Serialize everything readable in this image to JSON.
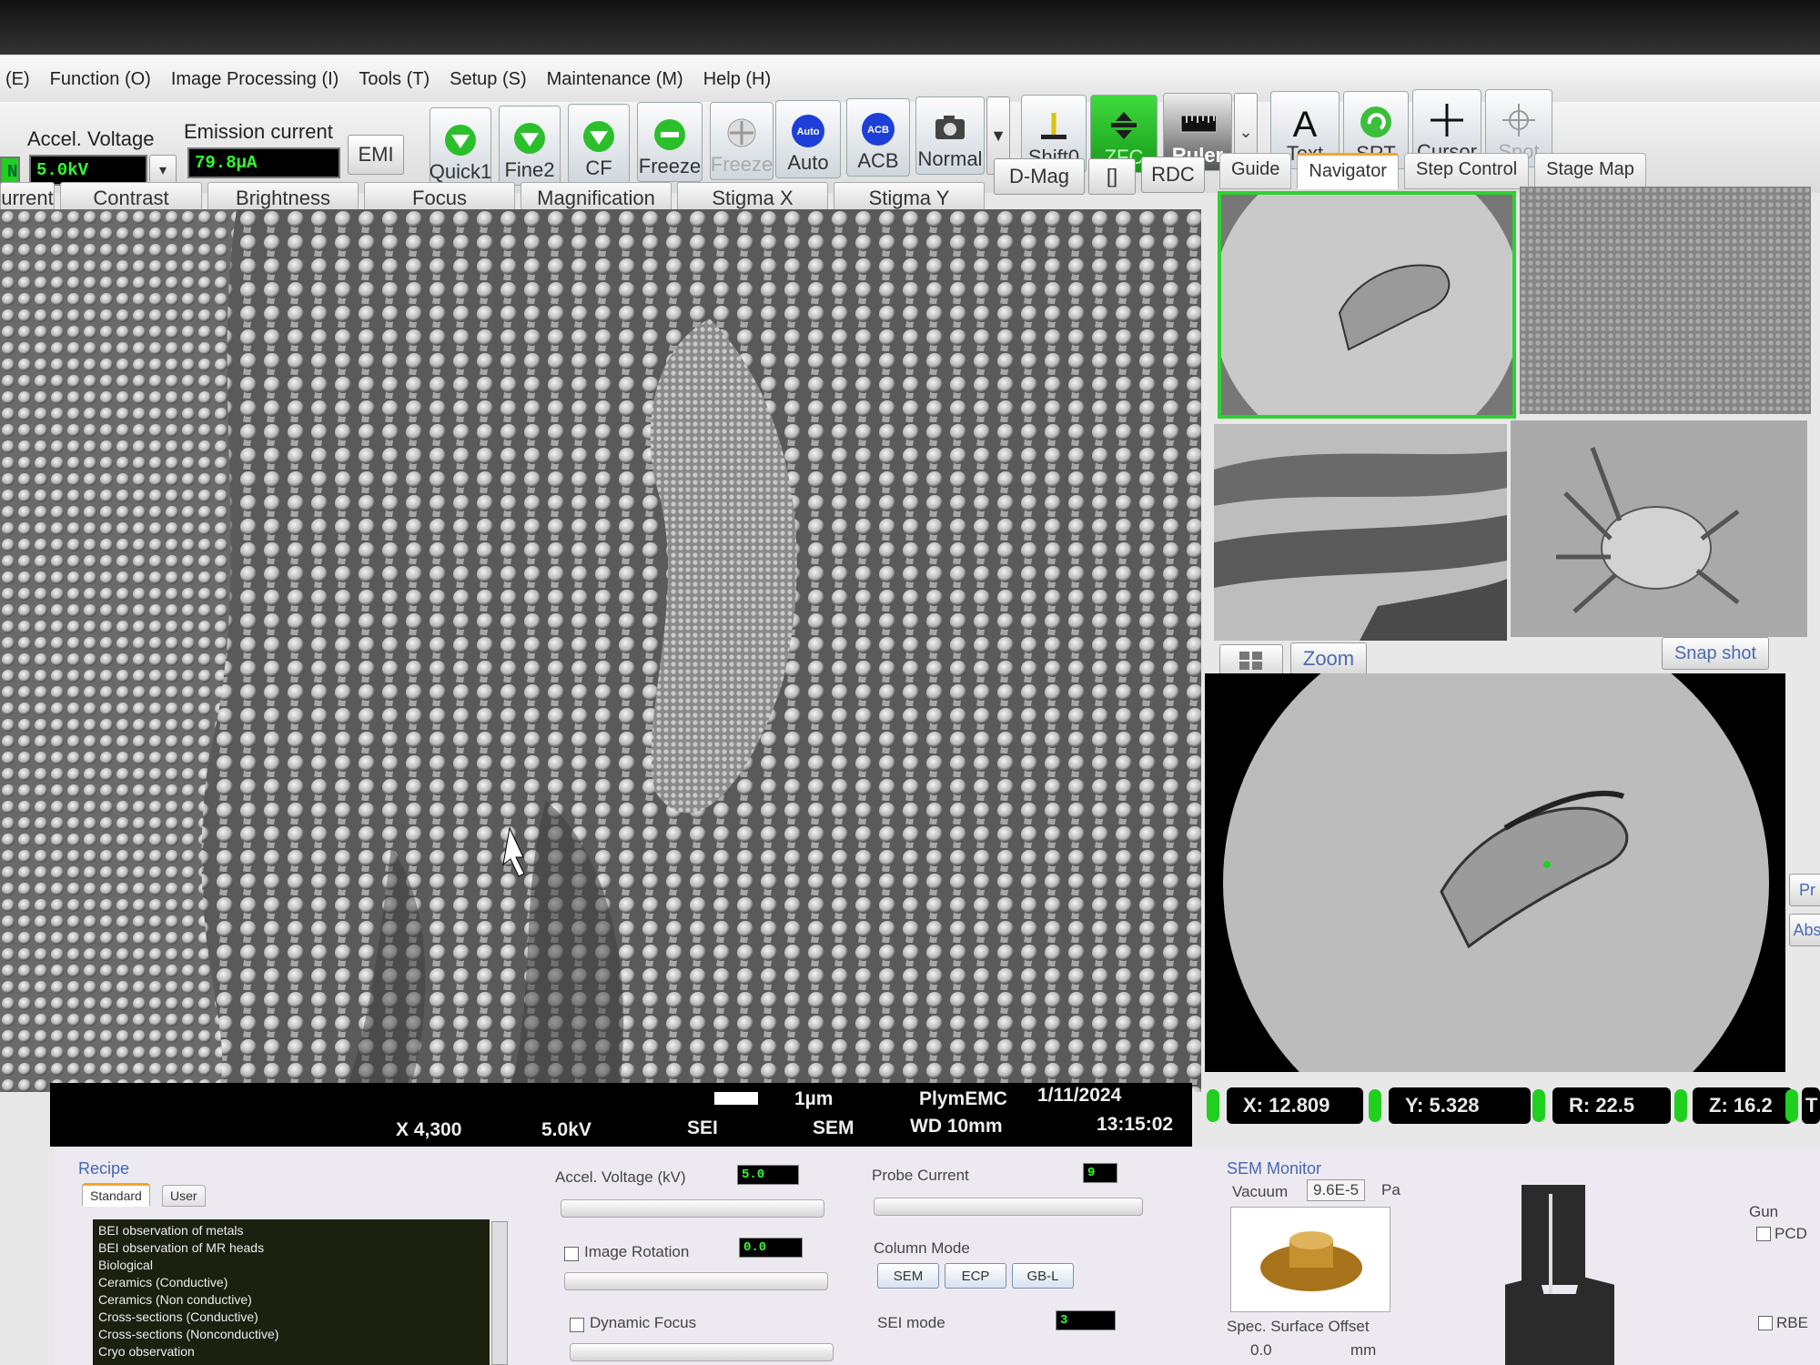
{
  "menu": [
    "(E)",
    "Function (O)",
    "Image Processing (I)",
    "Tools (T)",
    "Setup (S)",
    "Maintenance (M)",
    "Help (H)"
  ],
  "controls": {
    "accel_label": "Accel. Voltage",
    "accel_value": "5.0kV",
    "emission_label": "Emission current",
    "emission_value": "79.8µA",
    "emi_button": "EMI",
    "left_indicator": "N"
  },
  "toolbar": {
    "quick1": "Quick1",
    "fine2": "Fine2",
    "cf": "CF",
    "freeze": "Freeze",
    "freeze_dim": "Freeze",
    "auto": "Auto",
    "auto_icon": "Auto",
    "acb": "ACB",
    "acb_icon": "ACB",
    "normal": "Normal",
    "shift0": "Shift0",
    "zfc": "ZFC",
    "ruler": "Ruler",
    "text": "Text",
    "srt": "SRT",
    "cursor": "Cursor",
    "spot": "Spot"
  },
  "sliders": [
    "urrent",
    "Contrast",
    "Brightness",
    "Focus",
    "Magnification",
    "Stigma X",
    "Stigma Y"
  ],
  "side_buttons": {
    "dmag": "D-Mag",
    "bracket": "[]",
    "rdc": "RDC"
  },
  "tabs": [
    "Guide",
    "Navigator",
    "Step Control",
    "Stage Map"
  ],
  "navigator": {
    "zoom": "Zoom",
    "snapshot": "Snap shot"
  },
  "infobar": {
    "scale": "1µm",
    "lab": "PlymEMC",
    "date": "1/11/2024",
    "mag": "X 4,300",
    "kv": "5.0kV",
    "detector": "SEI",
    "mode": "SEM",
    "wd": "WD  10mm",
    "time": "13:15:02"
  },
  "stage": {
    "x": "X:  12.809",
    "y": "Y:  5.328",
    "r": "R:  22.5",
    "z": "Z: 16.2",
    "extra": "T"
  },
  "edge_buttons": [
    "Pr",
    "Abs"
  ],
  "recipe": {
    "title": "Recipe",
    "tabs": [
      "Standard",
      "User"
    ],
    "items": [
      "BEI observation of metals",
      "BEI observation of MR heads",
      "Biological",
      "Ceramics (Conductive)",
      "Ceramics (Non conductive)",
      "Cross-sections (Conductive)",
      "Cross-sections (Nonconductive)",
      "Cryo observation"
    ]
  },
  "params": {
    "accel_label": "Accel. Voltage (kV)",
    "accel_value": "5.0",
    "rotation_label": "Image Rotation",
    "rotation_value": "0.0",
    "dynamic_label": "Dynamic Focus",
    "probe_label": "Probe Current",
    "probe_value": "9",
    "column_label": "Column Mode",
    "column_modes": [
      "SEM",
      "ECP",
      "GB-L"
    ],
    "sei_label": "SEI mode",
    "sei_value": "3"
  },
  "monitor": {
    "title": "SEM Monitor",
    "vacuum_label": "Vacuum",
    "vacuum_value": "9.6E-5",
    "vacuum_unit": "Pa",
    "offset_label": "Spec. Surface Offset",
    "offset_value": "0.0",
    "offset_unit": "mm",
    "gun": "Gun",
    "pcd": "PCD",
    "rbe": "RBE"
  }
}
